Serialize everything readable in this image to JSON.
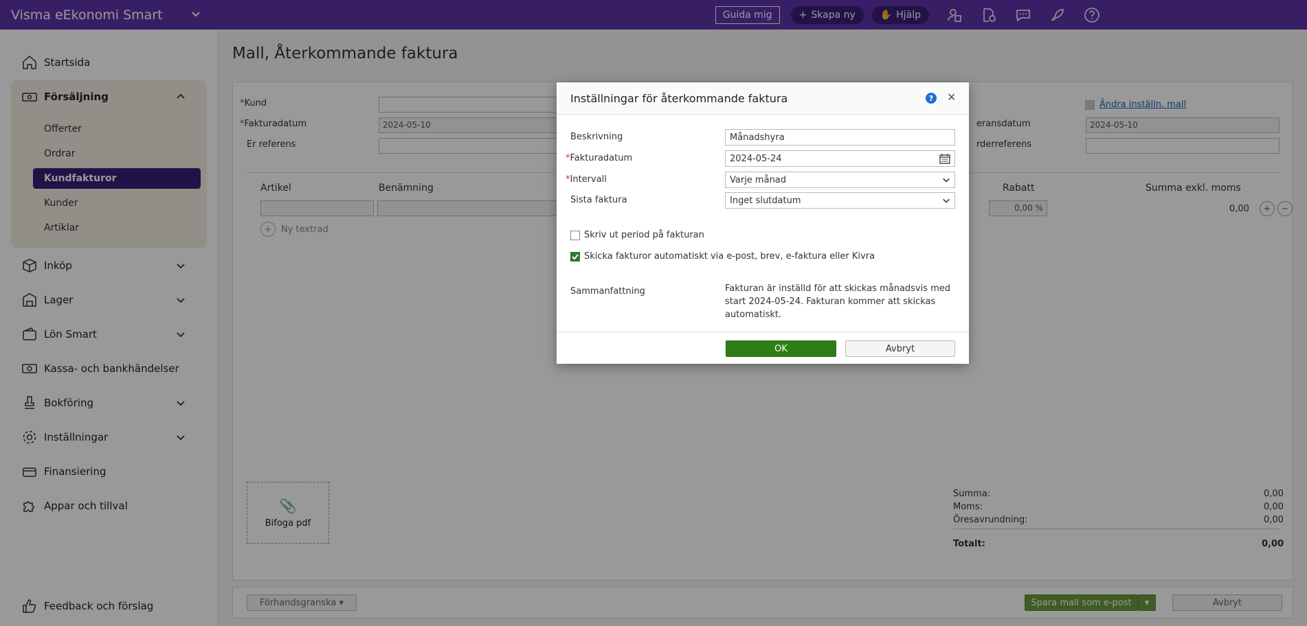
{
  "app": {
    "title": "Visma eEkonomi Smart"
  },
  "topbar": {
    "guide_label": "Guida mig",
    "create_label": "Skapa ny",
    "help_label": "Hjälp"
  },
  "sidebar": {
    "items": [
      {
        "label": "Startsida",
        "icon": "home-icon"
      },
      {
        "label": "Försäljning",
        "icon": "cash-register-icon"
      },
      {
        "label": "Inköp",
        "icon": "box-icon"
      },
      {
        "label": "Lager",
        "icon": "warehouse-icon"
      },
      {
        "label": "Lön Smart",
        "icon": "wallet-icon"
      },
      {
        "label": "Kassa- och bankhändelser",
        "icon": "banknote-icon"
      },
      {
        "label": "Bokföring",
        "icon": "stamp-icon"
      },
      {
        "label": "Inställningar",
        "icon": "gear-icon"
      },
      {
        "label": "Finansiering",
        "icon": "money-icon"
      },
      {
        "label": "Appar och tillval",
        "icon": "puzzle-icon"
      }
    ],
    "sub_items": [
      "Offerter",
      "Ordrar",
      "Kundfakturor",
      "Kunder",
      "Artiklar"
    ],
    "feedback": "Feedback och förslag"
  },
  "page": {
    "title": "Mall, Återkommande faktura",
    "fields": {
      "kund": "Kund",
      "fakturadatum": "Fakturadatum",
      "fakturadatum_value": "2024-05-10",
      "er_referens": "Er referens",
      "leveransdatum": "eransdatum",
      "leveransdatum_value": "2024-05-10",
      "orderreferens": "rderreferens",
      "andra_mall": "Ändra inställn. mall"
    },
    "table": {
      "headers": [
        "Artikel",
        "Benämning",
        "Rabatt",
        "Summa exkl. moms"
      ],
      "rabatt_value": "0,00 %",
      "sum_value": "0,00",
      "new_text_row": "Ny textrad"
    },
    "attach_label": "Bifoga pdf",
    "totals": [
      {
        "label": "Summa:",
        "value": "0,00"
      },
      {
        "label": "Moms:",
        "value": "0,00"
      },
      {
        "label": "Öresavrundning:",
        "value": "0,00"
      }
    ],
    "total": {
      "label": "Totalt:",
      "value": "0,00"
    },
    "footer": {
      "preview": "Förhandsgranska",
      "save": "Spara mall som e-post",
      "cancel": "Avbryt"
    }
  },
  "modal": {
    "title": "Inställningar för återkommande faktura",
    "beskrivning_label": "Beskrivning",
    "beskrivning_value": "Månadshyra",
    "fakturadatum_label": "Fakturadatum",
    "fakturadatum_value": "2024-05-24",
    "intervall_label": "Intervall",
    "intervall_value": "Varje månad",
    "sista_label": "Sista faktura",
    "sista_value": "Inget slutdatum",
    "checkbox1": "Skriv ut period på fakturan",
    "checkbox1_checked": false,
    "checkbox2": "Skicka fakturor automatiskt via e-post, brev, e-faktura eller Kivra",
    "checkbox2_checked": true,
    "summary_label": "Sammanfattning",
    "summary_text": "Fakturan är inställd för att skickas månadsvis med start 2024-05-24. Fakturan kommer att skickas automatiskt.",
    "ok": "OK",
    "cancel": "Avbryt"
  },
  "colors": {
    "brand": "#5e35a8",
    "active": "#3b1f78",
    "ok": "#2f7d16"
  }
}
